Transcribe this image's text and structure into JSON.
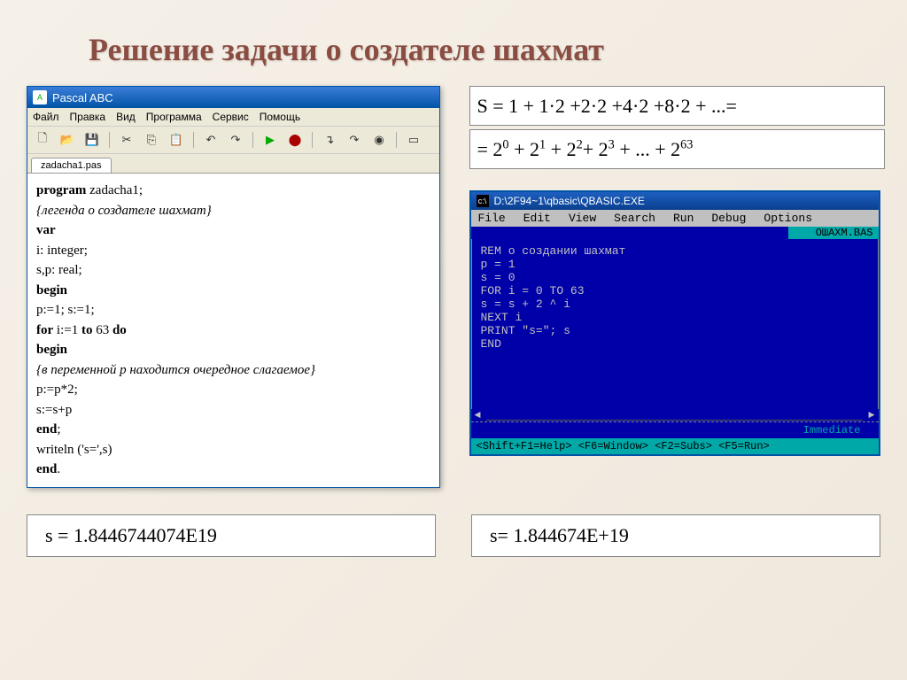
{
  "slide": {
    "title": "Решение задачи о создателе шахмат"
  },
  "pascal": {
    "window_title": "Pascal ABC",
    "menus": [
      "Файл",
      "Правка",
      "Вид",
      "Программа",
      "Сервис",
      "Помощь"
    ],
    "tab_name": "zadacha1.pas",
    "code_lines": [
      {
        "kw": "program",
        "rest": " zadacha1;"
      },
      {
        "cm": "{легенда о создателе шахмат}"
      },
      {
        "kw": "var",
        "rest": ""
      },
      {
        "rest": "i: integer;"
      },
      {
        "rest": "s,p: real;"
      },
      {
        "kw": "begin",
        "rest": ""
      },
      {
        "rest": "p:=1; s:=1;"
      },
      {
        "kw": "for",
        "rest": " i:=1 ",
        "kw2": "to",
        "rest2": " 63 ",
        "kw3": "do"
      },
      {
        "kw": "begin",
        "rest": ""
      },
      {
        "cm": "{в переменной p находится очередное слагаемое}"
      },
      {
        "rest": " p:=p*2;"
      },
      {
        "rest": " s:=s+p"
      },
      {
        "kw": "end",
        "rest": ";"
      },
      {
        "rest": " writeln ('s=',s)"
      },
      {
        "kw": "end",
        "rest": "."
      }
    ]
  },
  "formula": {
    "line1": "S = 1 + 1·2 +2·2 +4·2 +8·2 + ...=",
    "line2_html": "= 2<sup>0</sup> + 2<sup>1</sup> + 2<sup>2</sup>+ 2<sup>3</sup> + ... + 2<sup>63</sup>"
  },
  "qbasic": {
    "title_path": "D:\\2F94~1\\qbasic\\QBASIC.EXE",
    "menus": [
      "File",
      "Edit",
      "View",
      "Search",
      "Run",
      "Debug",
      "Options"
    ],
    "file_label": "ОШАХМ.BAS",
    "code_lines": [
      "REM о  создании шахмат",
      "p = 1",
      "s = 0",
      "FOR i = 0 TO 63",
      "s = s + 2 ^ i",
      "NEXT i",
      "PRINT \"s=\"; s",
      "END"
    ],
    "immediate_label": "Immediate",
    "status_hint": "<Shift+F1=Help> <F6=Window> <F2=Subs> <F5=Run>"
  },
  "results": {
    "left": "s = 1.8446744074E19",
    "right": "s= 1.844674E+19"
  }
}
